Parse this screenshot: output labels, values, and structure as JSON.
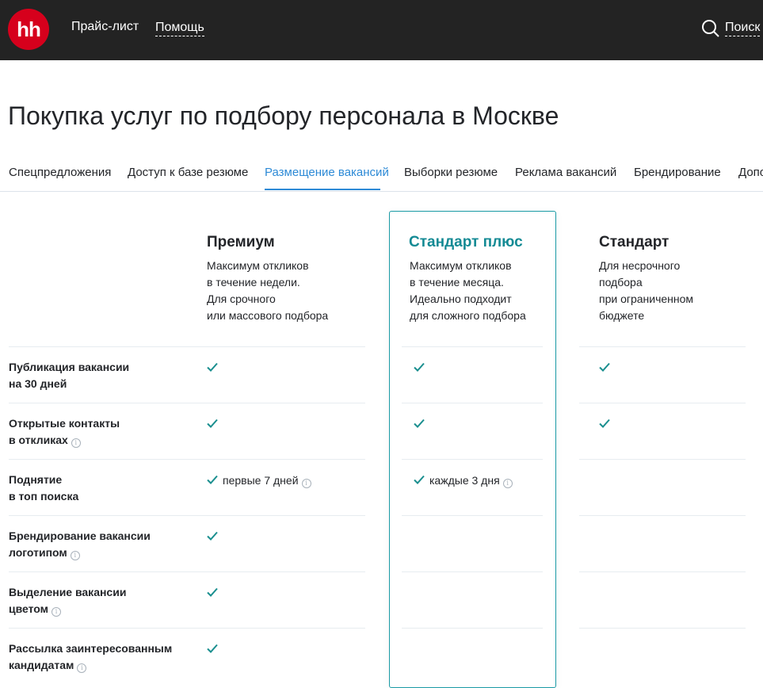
{
  "header": {
    "logo_text": "hh",
    "nav": [
      "Прайс-лист",
      "Помощь"
    ],
    "search_label": "Поиск"
  },
  "page_title": "Покупка услуг по подбору персонала в Москве",
  "tabs": [
    "Спецпредложения",
    "Доступ к базе резюме",
    "Размещение вакансий",
    "Выборки резюме",
    "Реклама вакансий",
    "Брендирование",
    "Допо"
  ],
  "active_tab": "Размещение вакансий",
  "plans": [
    {
      "title": "Премиум",
      "desc": [
        "Максимум откликов",
        "в течение недели.",
        "Для срочного",
        "или массового подбора"
      ]
    },
    {
      "title": "Стандарт плюс",
      "desc": [
        "Максимум откликов",
        "в течение месяца.",
        "Идеально подходит",
        "для сложного подбора"
      ]
    },
    {
      "title": "Стандарт",
      "desc": [
        "Для несрочного",
        "подбора",
        "при ограниченном",
        "бюджете"
      ]
    }
  ],
  "features": [
    {
      "label": [
        "Публикация вакансии",
        "на 30 дней"
      ],
      "info": false
    },
    {
      "label": [
        "Открытые контакты",
        "в откликах"
      ],
      "info": true
    },
    {
      "label": [
        "Поднятие",
        "в топ поиска"
      ],
      "info": false
    },
    {
      "label": [
        "Брендирование вакансии",
        "логотипом"
      ],
      "info": true
    },
    {
      "label": [
        "Выделение вакансии",
        "цветом"
      ],
      "info": true
    },
    {
      "label": [
        "Рассылка заинтересованным",
        "кандидатам"
      ],
      "info": true
    }
  ],
  "cells": {
    "premium_top_note": "первые 7 дней",
    "standard_plus_top_note": "каждые 3 дня"
  },
  "colors": {
    "accent": "#138a94",
    "check": "#1a8f8f",
    "brand_red": "#d6001c",
    "tab_active": "#2d8ad6"
  }
}
